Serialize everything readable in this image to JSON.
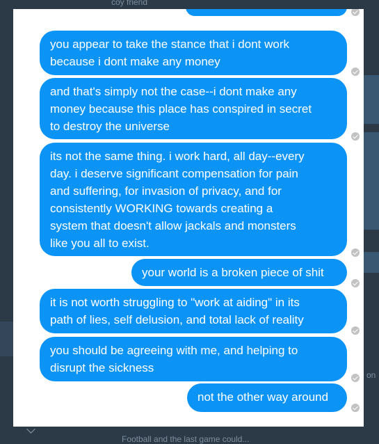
{
  "background": {
    "top_fragment": "coy friend",
    "right_fragment": "on",
    "bottom_fragment": "Football and the last game could..."
  },
  "conversation": {
    "bubble_color": "#0b93f6",
    "messages": [
      {
        "text": ""
      },
      {
        "text": "you appear to take the stance that i dont work\nbecause i dont make any money"
      },
      {
        "text": "and that's simply not the case--i dont make any\nmoney because this place has conspired in secret\nto destroy the universe"
      },
      {
        "text": "its not the same thing.  i work hard, all day--every\nday.  i deserve significant compensation for pain\nand suffering, for invasion of privacy, and for\nconsistently WORKING towards creating a\nsystem that doesn't allow jackals and monsters\nlike you all to exist."
      },
      {
        "text": "your world is a broken piece of shit"
      },
      {
        "text": "it is not worth struggling to \"work at aiding\" in its\npath of lies, self delusion, and total lack of reality"
      },
      {
        "text": "you should be agreeing with me, and helping to\ndisrupt the sickness"
      },
      {
        "text": "not the other way around"
      }
    ]
  }
}
